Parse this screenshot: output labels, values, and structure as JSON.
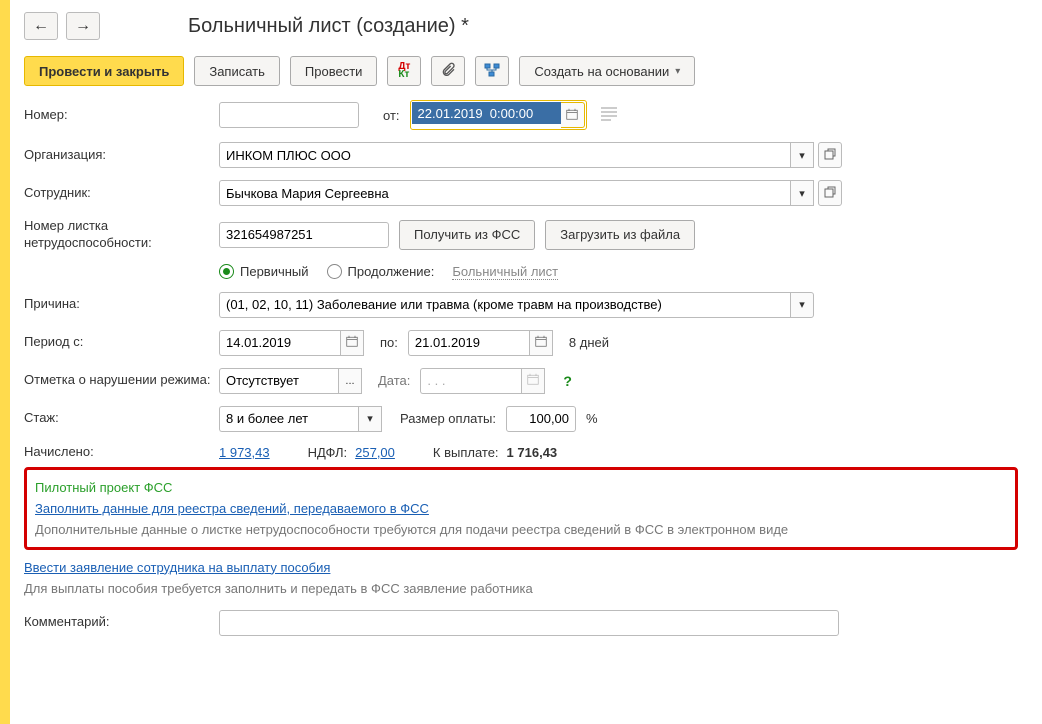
{
  "title": "Больничный лист (создание) *",
  "toolbar": {
    "post_close": "Провести и закрыть",
    "save": "Записать",
    "post": "Провести",
    "create_based": "Создать на основании"
  },
  "labels": {
    "number": "Номер:",
    "from": "от:",
    "org": "Организация:",
    "employee": "Сотрудник:",
    "cert_no": "Номер листка нетрудоспособности:",
    "get_fss": "Получить из ФСС",
    "load_file": "Загрузить из файла",
    "primary": "Первичный",
    "continuation": "Продолжение:",
    "sickleave_link": "Больничный лист",
    "reason": "Причина:",
    "period_from": "Период с:",
    "to": "по:",
    "days": "8 дней",
    "violation": "Отметка о нарушении режима:",
    "date": "Дата:",
    "seniority": "Стаж:",
    "pay_rate": "Размер оплаты:",
    "percent": "%",
    "accrued": "Начислено:",
    "ndfl": "НДФЛ:",
    "topay": "К выплате:",
    "comment": "Комментарий:"
  },
  "values": {
    "number": "",
    "date": "22.01.2019  0:00:00",
    "org": "ИНКОМ ПЛЮС ООО",
    "employee": "Бычкова Мария Сергеевна",
    "cert_no": "321654987251",
    "reason": "(01, 02, 10, 11) Заболевание или травма (кроме травм на производстве)",
    "period_from": "14.01.2019",
    "period_to": "21.01.2019",
    "violation": "Отсутствует",
    "violation_date_placeholder": ". . .",
    "seniority": "8 и более лет",
    "pay_rate": "100,00",
    "accrued": "1 973,43",
    "ndfl": "257,00",
    "topay": "1 716,43",
    "comment": ""
  },
  "pilot": {
    "title": "Пилотный проект ФСС",
    "link": "Заполнить данные для реестра сведений, передаваемого в ФСС",
    "desc": "Дополнительные данные о листке нетрудоспособности требуются для подачи реестра сведений в ФСС в электронном виде"
  },
  "app": {
    "link": "Ввести заявление сотрудника на выплату пособия",
    "desc": "Для выплаты пособия требуется заполнить и передать в ФСС заявление работника"
  }
}
